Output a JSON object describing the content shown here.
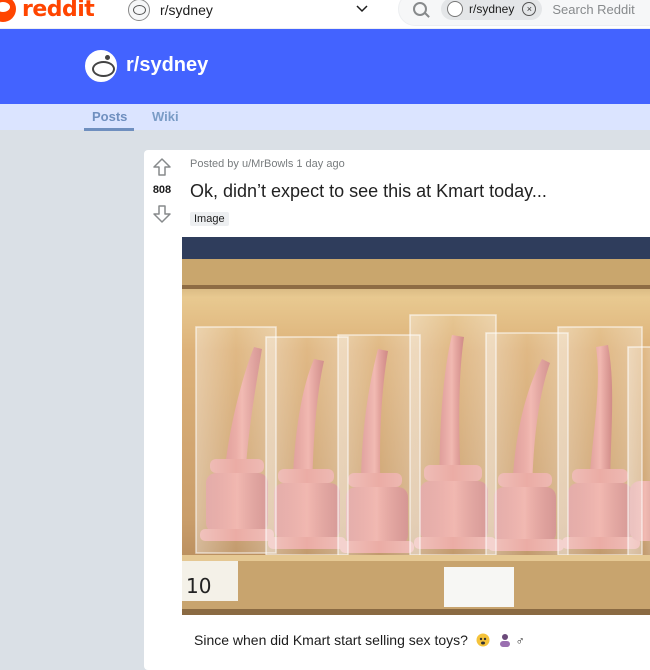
{
  "header": {
    "logo_text": "reddit",
    "community_picker": "r/sydney",
    "search_chip": "r/sydney",
    "search_placeholder": "Search Reddit"
  },
  "banner": {
    "subreddit_name": "r/sydney",
    "color": "#4363ff"
  },
  "tabs": [
    {
      "label": "Posts",
      "active": true
    },
    {
      "label": "Wiki",
      "active": false
    }
  ],
  "post": {
    "score": "808",
    "meta": "Posted by u/MrBowls 1 day ago",
    "title": "Ok, didn’t expect to see this at Kmart today...",
    "flair": "Image",
    "price_tag": "10",
    "body": "Since when did Kmart start selling sex toys?"
  },
  "icons": [
    "search-icon",
    "close-icon",
    "chevron-down-icon",
    "upvote-icon",
    "downvote-icon"
  ]
}
